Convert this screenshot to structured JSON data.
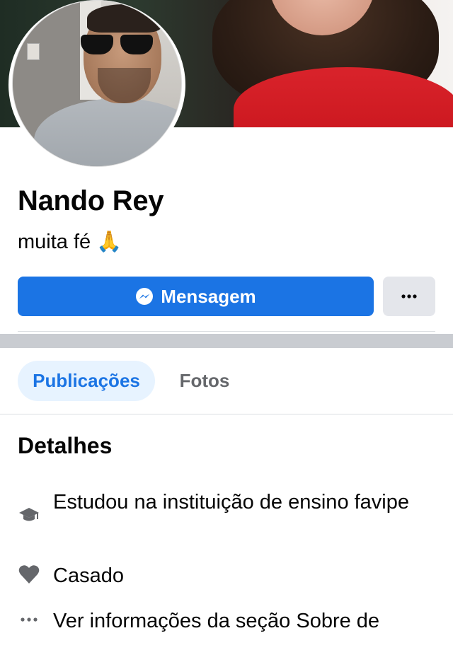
{
  "profile": {
    "name": "Nando Rey",
    "bio": "muita fé 🙏"
  },
  "actions": {
    "message_label": "Mensagem",
    "more_label": "···"
  },
  "tabs": [
    {
      "label": "Publicações",
      "active": true
    },
    {
      "label": "Fotos",
      "active": false
    }
  ],
  "details": {
    "title": "Detalhes",
    "items": [
      {
        "icon": "graduation-cap-icon",
        "text": "Estudou na instituição de ensino favipe"
      },
      {
        "icon": "heart-icon",
        "text": "Casado"
      },
      {
        "icon": "more-dots-icon",
        "text": "Ver informações da seção Sobre de"
      }
    ]
  },
  "colors": {
    "accent": "#1b74e4",
    "accent_tint": "#e7f3ff",
    "secondary_button": "#e4e6eb",
    "muted_text": "#65676b",
    "divider": "#c9ccd1"
  }
}
